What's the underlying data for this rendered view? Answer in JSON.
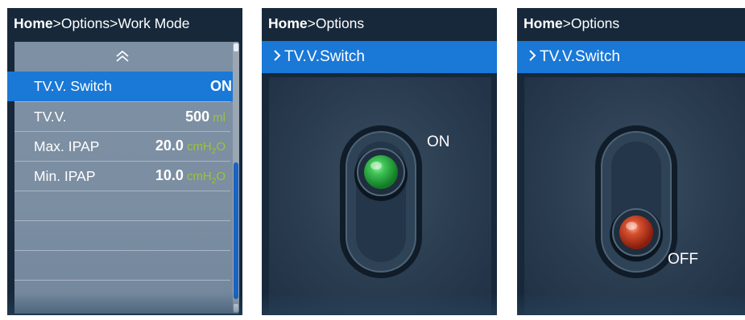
{
  "panels": [
    {
      "breadcrumb": {
        "home": "Home",
        "rest": ">Options>Work Mode"
      },
      "rows": [
        {
          "label": "TV.V. Switch",
          "value": "ON",
          "unit": "",
          "selected": true
        },
        {
          "label": "TV.V.",
          "value": "500",
          "unit": "ml",
          "selected": false
        },
        {
          "label": "Max. IPAP",
          "value": "20.0",
          "unit": "cmH2O",
          "selected": false
        },
        {
          "label": "Min. IPAP",
          "value": "10.0",
          "unit": "cmH2O",
          "selected": false
        }
      ]
    },
    {
      "breadcrumb": {
        "home": "Home",
        "rest": ">Options"
      },
      "menu_item": "TV.V.Switch",
      "state_label": "ON",
      "knob_color": "#2fb24a"
    },
    {
      "breadcrumb": {
        "home": "Home",
        "rest": ">Options"
      },
      "menu_item": "TV.V.Switch",
      "state_label": "OFF",
      "knob_color": "#c4381e"
    }
  ],
  "colors": {
    "accent": "#1a78d6",
    "unit": "#9ac43a",
    "background": "#17283a"
  },
  "icons": {
    "scroll_up": "double-chevron-up-icon",
    "menu_item": "chevron-right-icon"
  }
}
